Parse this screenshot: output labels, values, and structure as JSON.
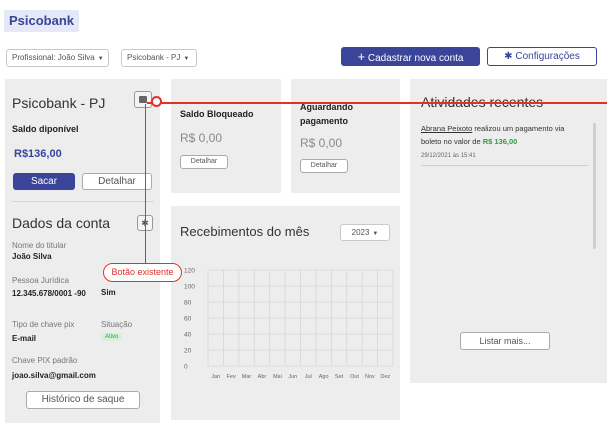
{
  "app": {
    "title": "Psicobank"
  },
  "filters": {
    "professional": "Profissional: João Silva",
    "account": "Psicobank - PJ"
  },
  "toolbar": {
    "new_account": "Cadastrar nova conta",
    "settings": "Configurações"
  },
  "account": {
    "name": "Psicobank - PJ",
    "balance_label": "Saldo diponível",
    "balance_value": "R$136,00",
    "withdraw": "Sacar",
    "details": "Detalhar"
  },
  "blocked": {
    "label": "Saldo Bloqueado",
    "value": "R$ 0,00",
    "details": "Detalhar"
  },
  "pending": {
    "label": "Aguardando pagamento",
    "value": "R$ 0,00",
    "details": "Detalhar"
  },
  "account_data": {
    "title": "Dados da conta",
    "holder_label": "Nome do titular",
    "holder_value": "João Silva",
    "legal_label": "Pessoa Jurídica",
    "legal_value": "12.345.678/0001 -90",
    "other_value": "Sim",
    "pix_type_label": "Tipo de chave pix",
    "pix_type_value": "E-mail",
    "status_label": "Situação",
    "status_value": "Ativo",
    "pix_key_label": "Chave PIX padrão",
    "pix_key_value": "joao.silva@gmail.com",
    "history": "Histórico de saque"
  },
  "annotation": {
    "label": "Botão existente"
  },
  "chart_data": {
    "type": "line",
    "title": "Recebimentos do mês",
    "year": "2023",
    "categories": [
      "Jan",
      "Fev",
      "Mar",
      "Abr",
      "Mai",
      "Jun",
      "Jul",
      "Ago",
      "Set",
      "Out",
      "Nov",
      "Dez"
    ],
    "y_ticks": [
      0,
      20,
      40,
      60,
      80,
      100,
      120
    ],
    "ylim": [
      0,
      120
    ],
    "grid": true,
    "series": []
  },
  "activity": {
    "title": "Atividades recentes",
    "entry_name": "Abrana Peixoto",
    "entry_text": " realizou um pagamento via boleto no valor de ",
    "entry_value": "R$ 136,00",
    "entry_time": "29/12/2021 às 15:41",
    "more": "Listar mais..."
  },
  "colors": {
    "primary": "#3a4499",
    "annotation": "#e2302b",
    "active": "#2e9e3e"
  }
}
